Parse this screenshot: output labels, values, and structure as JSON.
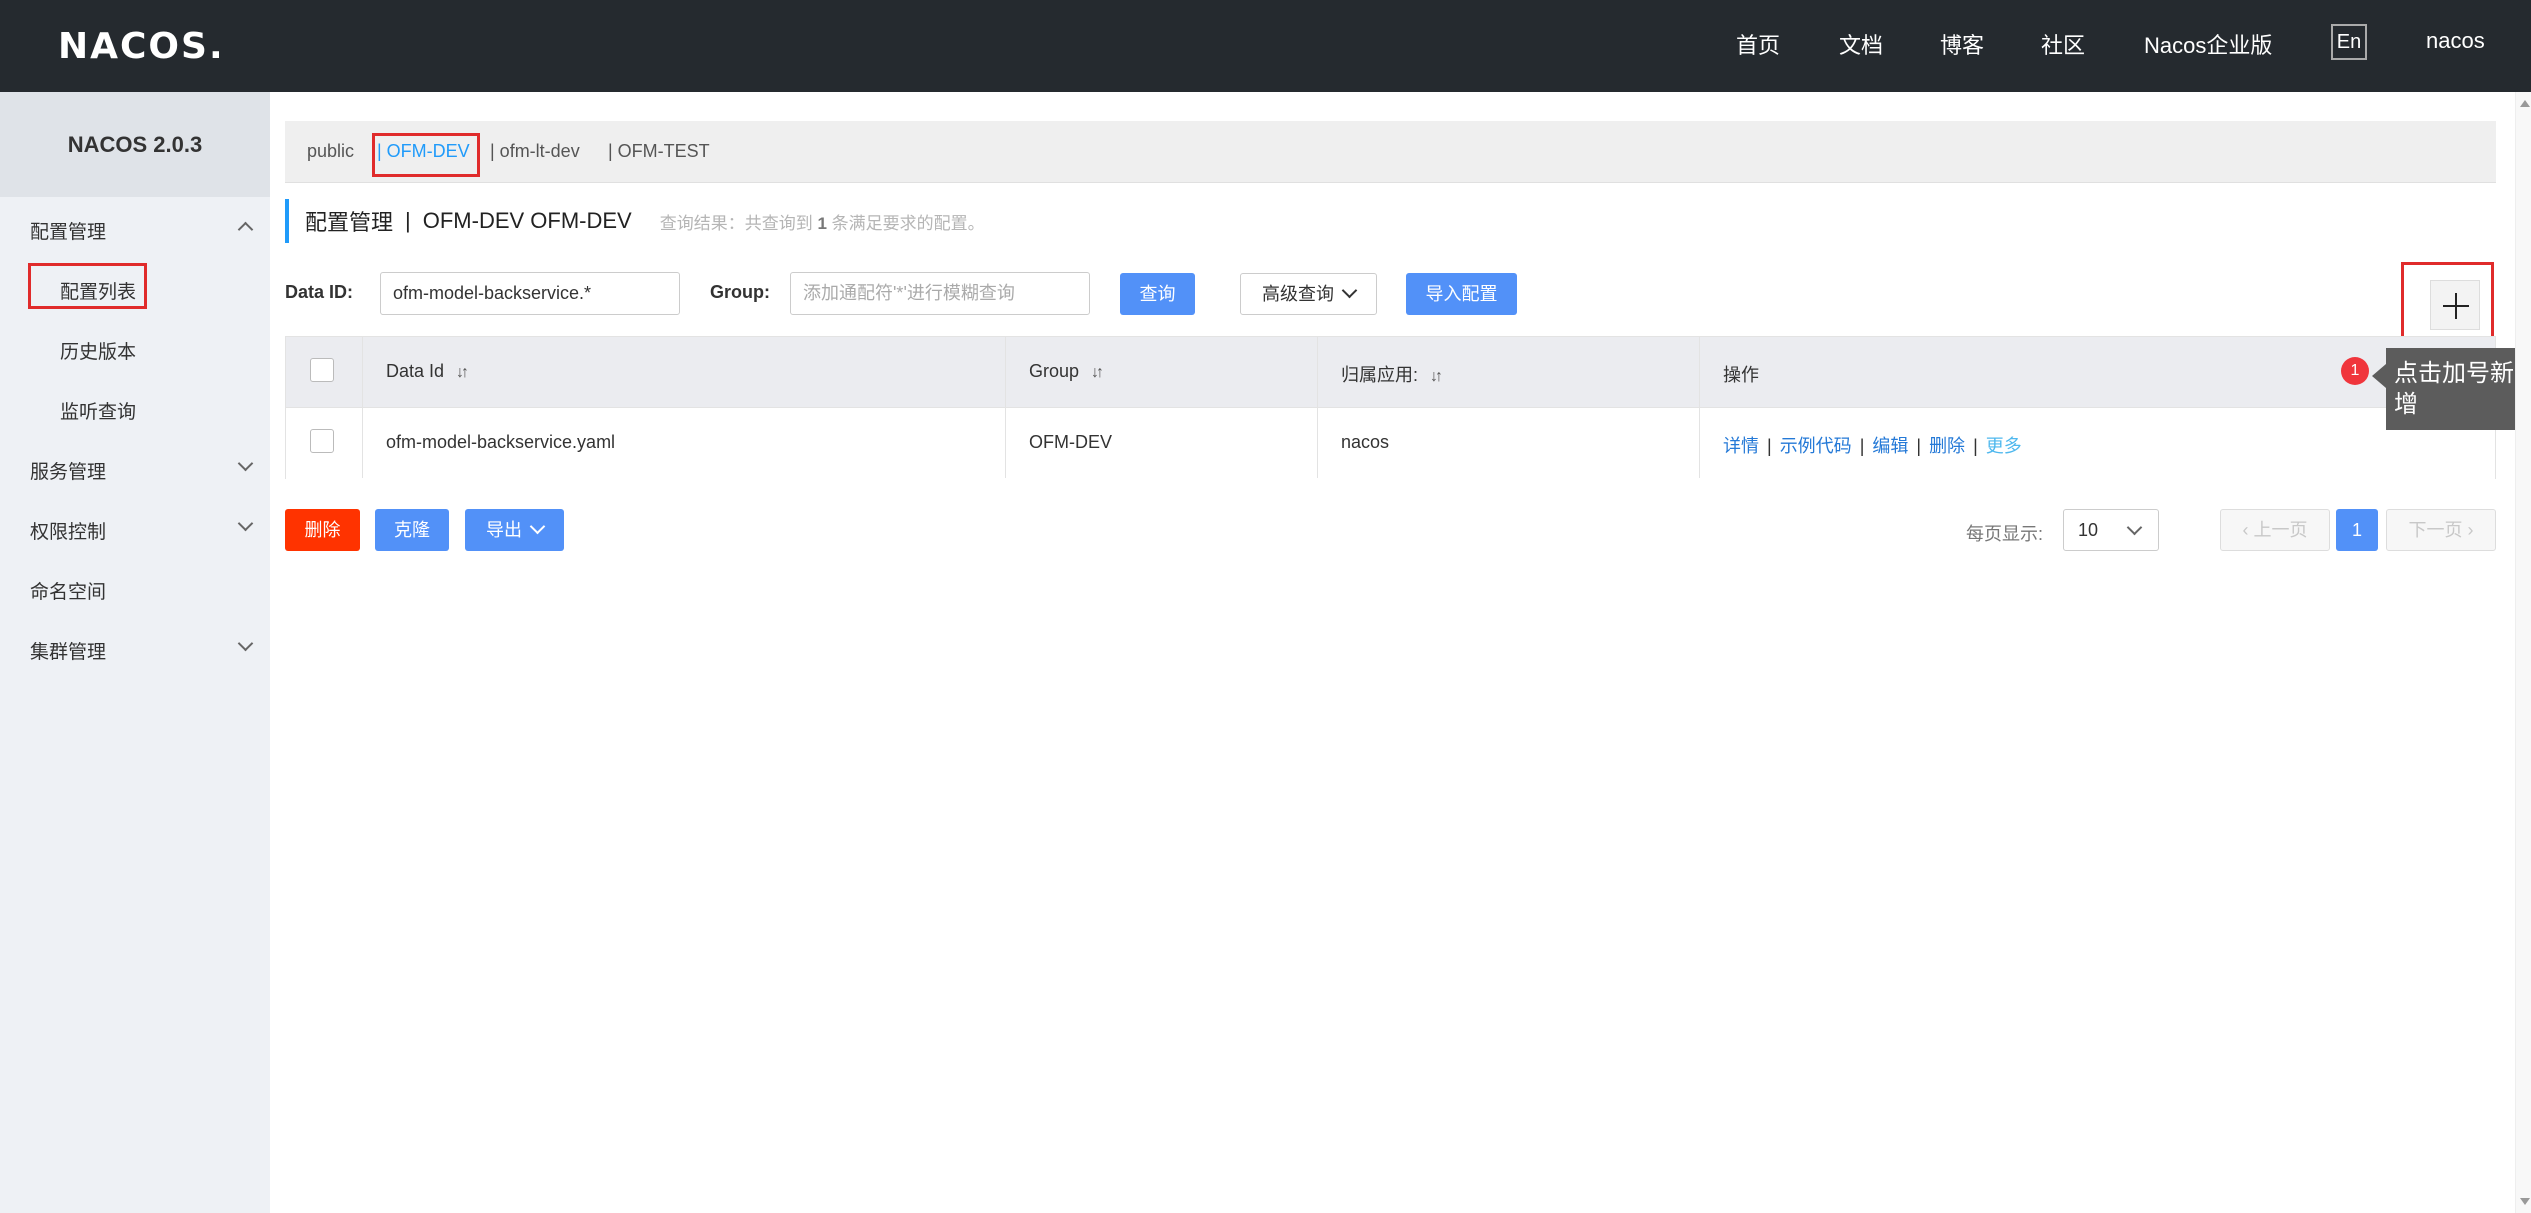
{
  "header": {
    "logo": "NACOS.",
    "nav": [
      "首页",
      "文档",
      "博客",
      "社区",
      "Nacos企业版"
    ],
    "lang": "En",
    "user": "nacos"
  },
  "sidebar": {
    "title": "NACOS 2.0.3",
    "items": [
      {
        "label": "配置管理",
        "expanded": true
      },
      {
        "label": "配置列表",
        "active": true
      },
      {
        "label": "历史版本"
      },
      {
        "label": "监听查询"
      },
      {
        "label": "服务管理"
      },
      {
        "label": "权限控制"
      },
      {
        "label": "命名空间"
      },
      {
        "label": "集群管理"
      }
    ]
  },
  "namespaces": [
    {
      "label": "public"
    },
    {
      "label": "| OFM-DEV",
      "active": true
    },
    {
      "label": "| ofm-lt-dev"
    },
    {
      "label": "| OFM-TEST"
    }
  ],
  "page": {
    "title": "配置管理",
    "separator": "|",
    "namespace": "OFM-DEV  OFM-DEV",
    "result_prefix": "查询结果：共查询到",
    "result_count": "1",
    "result_suffix": "条满足要求的配置。"
  },
  "query": {
    "dataid_label": "Data ID:",
    "dataid_value": "ofm-model-backservice.*",
    "group_label": "Group:",
    "group_placeholder": "添加通配符'*'进行模糊查询",
    "search_button": "查询",
    "advanced_button": "高级查询",
    "import_button": "导入配置"
  },
  "table": {
    "headers": [
      "Data Id",
      "Group",
      "归属应用:",
      "操作"
    ],
    "rows": [
      {
        "data_id": "ofm-model-backservice.yaml",
        "group": "OFM-DEV",
        "app": "nacos",
        "actions": [
          "详情",
          "示例代码",
          "编辑",
          "删除",
          "更多"
        ]
      }
    ]
  },
  "bottom": {
    "delete": "删除",
    "clone": "克隆",
    "export": "导出"
  },
  "pagination": {
    "per_page_label": "每页显示:",
    "per_page": "10",
    "prev": "上一页",
    "current": "1",
    "next": "下一页"
  },
  "callout": {
    "badge": "1",
    "text": "点击加号新增"
  },
  "colors": {
    "header_bg": "#252a2f",
    "primary": "#5291f8",
    "danger": "#ff3300",
    "highlight_border": "#e02b2b",
    "link": "#2479d7"
  }
}
